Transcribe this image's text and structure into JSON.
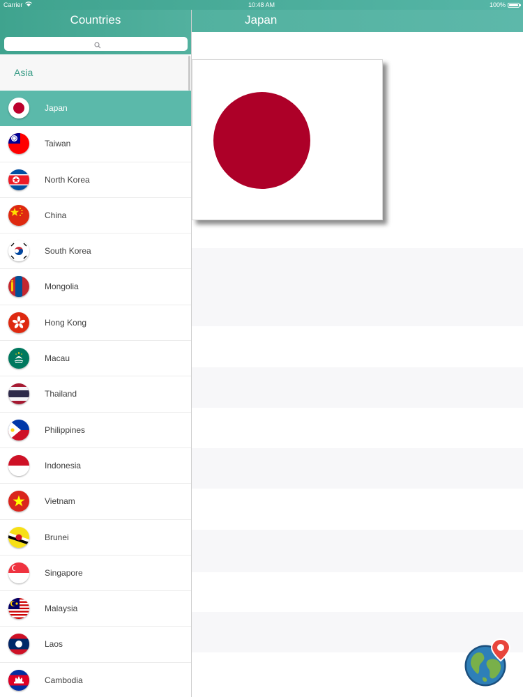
{
  "status_bar": {
    "carrier": "Carrier",
    "time": "10:48 AM",
    "battery": "100%"
  },
  "master": {
    "title": "Countries",
    "search": {
      "placeholder": "",
      "value": ""
    },
    "section": "Asia",
    "selected_index": 0,
    "countries": [
      {
        "name": "Japan",
        "flag": "flag-japan"
      },
      {
        "name": "Taiwan",
        "flag": "flag-taiwan"
      },
      {
        "name": "North Korea",
        "flag": "flag-north-korea"
      },
      {
        "name": "China",
        "flag": "flag-china"
      },
      {
        "name": "South Korea",
        "flag": "flag-south-korea"
      },
      {
        "name": "Mongolia",
        "flag": "flag-mongolia"
      },
      {
        "name": "Hong Kong",
        "flag": "flag-hong-kong"
      },
      {
        "name": "Macau",
        "flag": "flag-macau"
      },
      {
        "name": "Thailand",
        "flag": "flag-thailand"
      },
      {
        "name": "Philippines",
        "flag": "flag-philippines"
      },
      {
        "name": "Indonesia",
        "flag": "flag-indonesia"
      },
      {
        "name": "Vietnam",
        "flag": "flag-vietnam"
      },
      {
        "name": "Brunei",
        "flag": "flag-brunei"
      },
      {
        "name": "Singapore",
        "flag": "flag-singapore"
      },
      {
        "name": "Malaysia",
        "flag": "flag-malaysia"
      },
      {
        "name": "Laos",
        "flag": "flag-laos"
      },
      {
        "name": "Cambodia",
        "flag": "flag-cambodia"
      }
    ]
  },
  "detail": {
    "title": "Japan",
    "flag_icon": "flag-japan",
    "map_button_icon": "globe-map-pin-icon"
  },
  "colors": {
    "header_teal": "#52b19f",
    "selected_row": "#5bb9aa",
    "section_text": "#3c9d88",
    "japan_red": "#ad0028"
  }
}
